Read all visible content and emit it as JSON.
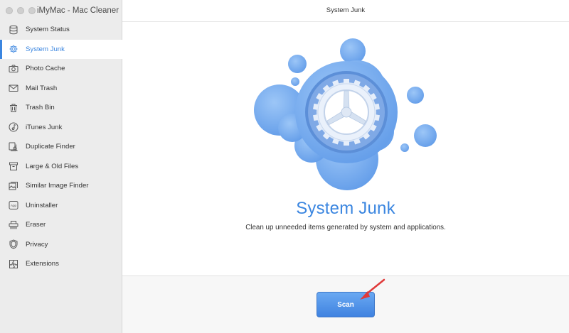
{
  "app": {
    "title": "iMyMac - Mac Cleaner"
  },
  "sidebar": {
    "items": [
      {
        "label": "System Status",
        "icon": "database-icon",
        "active": false
      },
      {
        "label": "System Junk",
        "icon": "gear-icon",
        "active": true
      },
      {
        "label": "Photo Cache",
        "icon": "camera-icon",
        "active": false
      },
      {
        "label": "Mail Trash",
        "icon": "mail-icon",
        "active": false
      },
      {
        "label": "Trash Bin",
        "icon": "trash-icon",
        "active": false
      },
      {
        "label": "iTunes Junk",
        "icon": "music-note-icon",
        "active": false
      },
      {
        "label": "Duplicate Finder",
        "icon": "duplicate-search-icon",
        "active": false
      },
      {
        "label": "Large & Old Files",
        "icon": "archive-box-icon",
        "active": false
      },
      {
        "label": "Similar Image Finder",
        "icon": "image-stack-icon",
        "active": false
      },
      {
        "label": "Uninstaller",
        "icon": "app-icon",
        "active": false
      },
      {
        "label": "Eraser",
        "icon": "shredder-icon",
        "active": false
      },
      {
        "label": "Privacy",
        "icon": "shield-icon",
        "active": false
      },
      {
        "label": "Extensions",
        "icon": "puzzle-icon",
        "active": false
      }
    ]
  },
  "main": {
    "window_title": "System Junk",
    "heading": "System Junk",
    "description": "Clean up unneeded items generated by system and applications.",
    "scan_label": "Scan"
  },
  "colors": {
    "accent": "#3b86e0",
    "bubble": "#7eb0ef",
    "sidebar_bg": "#ececec",
    "arrow": "#e03a3a"
  }
}
